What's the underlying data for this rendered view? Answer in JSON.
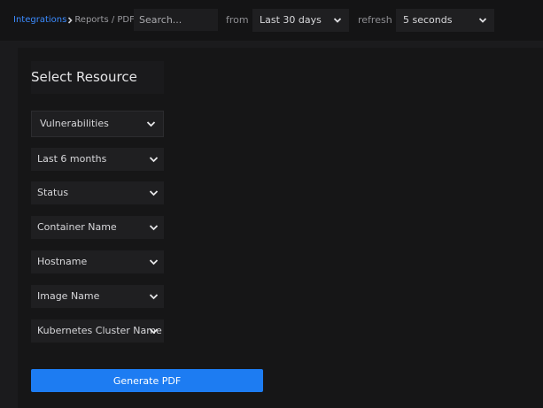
{
  "breadcrumb": {
    "link": "Integrations",
    "rest": "Reports / PDF"
  },
  "search": {
    "placeholder": "Search..."
  },
  "time_range": {
    "label": "from",
    "value": "Last 30 days"
  },
  "refresh": {
    "label": "refresh",
    "value": "5 seconds"
  },
  "panel": {
    "title": "Select Resource",
    "dropdowns": [
      {
        "label": "Vulnerabilities"
      },
      {
        "label": "Last 6 months"
      },
      {
        "label": "Status"
      },
      {
        "label": "Container Name"
      },
      {
        "label": "Hostname"
      },
      {
        "label": "Image Name"
      },
      {
        "label": "Kubernetes Cluster Name"
      }
    ],
    "generate_label": "Generate PDF"
  },
  "colors": {
    "accent": "#1d7cf2",
    "link": "#3b8bff",
    "background": "#1b1b1d"
  }
}
